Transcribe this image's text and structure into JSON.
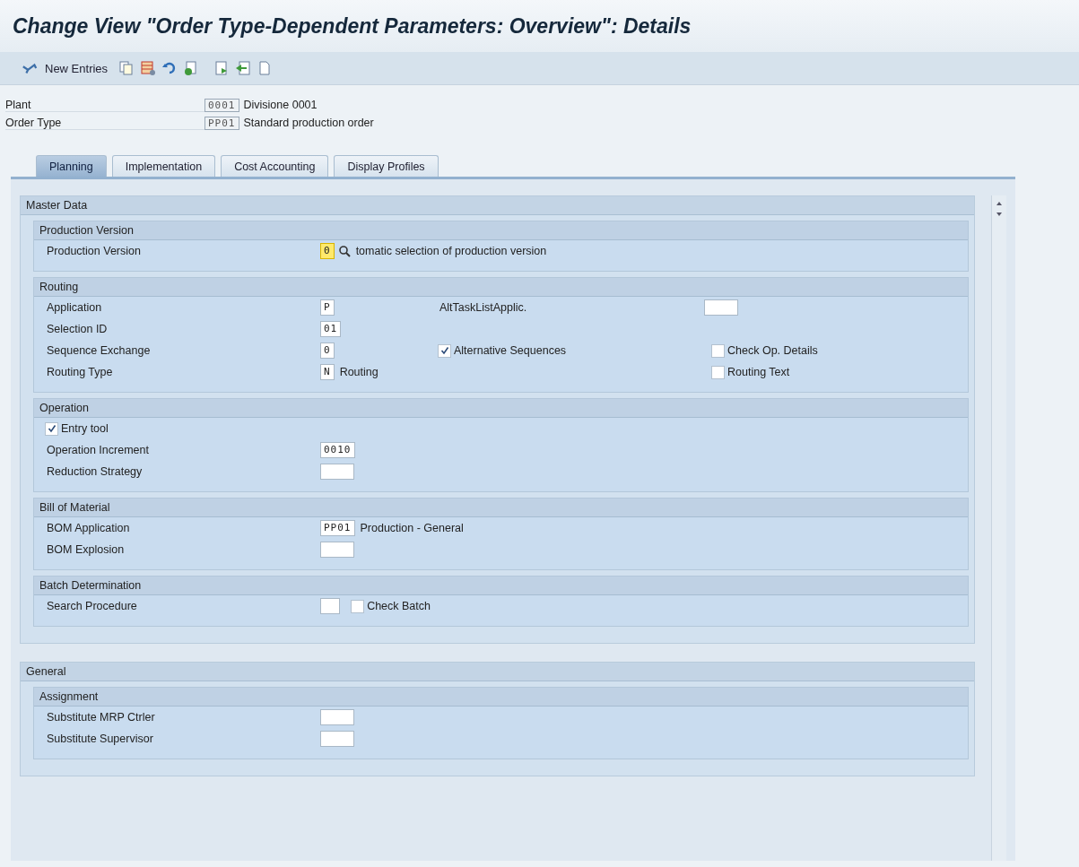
{
  "window": {
    "title": "Change View \"Order Type-Dependent Parameters: Overview\": Details"
  },
  "toolbar": {
    "new_entries": "New Entries"
  },
  "header": [
    {
      "label": "Plant",
      "value": "0001",
      "description": "Divisione 0001"
    },
    {
      "label": "Order Type",
      "value": "PP01",
      "description": "Standard production order"
    }
  ],
  "tabs": [
    {
      "label": "Planning",
      "selected": true
    },
    {
      "label": "Implementation",
      "selected": false
    },
    {
      "label": "Cost Accounting",
      "selected": false
    },
    {
      "label": "Display Profiles",
      "selected": false
    }
  ],
  "sections": [
    {
      "title": "Master Data",
      "groups": [
        {
          "title": "Production Version",
          "rows": [
            {
              "cells": [
                [
                  {
                    "kind": "label",
                    "text": "Production Version"
                  }
                ],
                [
                  {
                    "kind": "field",
                    "value": "0",
                    "focused": true
                  },
                  {
                    "kind": "search_help"
                  },
                  {
                    "kind": "text",
                    "text": "tomatic selection of production version"
                  }
                ]
              ]
            }
          ]
        },
        {
          "title": "Routing",
          "rows": [
            {
              "cells": [
                [
                  {
                    "kind": "label",
                    "text": "Application"
                  }
                ],
                [
                  {
                    "kind": "field",
                    "value": "P"
                  }
                ],
                [
                  {
                    "kind": "label",
                    "text": "AltTaskListApplic."
                  }
                ],
                [
                  {
                    "kind": "field"
                  }
                ]
              ]
            },
            {
              "cells": [
                [
                  {
                    "kind": "label",
                    "text": "Selection ID"
                  }
                ],
                [
                  {
                    "kind": "field",
                    "value": "01"
                  }
                ]
              ]
            },
            {
              "cells": [
                [
                  {
                    "kind": "label",
                    "text": "Sequence Exchange"
                  }
                ],
                [
                  {
                    "kind": "field",
                    "value": "0"
                  }
                ],
                [
                  {
                    "kind": "checkbox",
                    "label": "Alternative Sequences",
                    "checked": true
                  }
                ],
                [
                  {
                    "kind": "checkbox",
                    "label": "Check Op. Details",
                    "checked": false
                  }
                ]
              ]
            },
            {
              "cells": [
                [
                  {
                    "kind": "label",
                    "text": "Routing Type"
                  }
                ],
                [
                  {
                    "kind": "field",
                    "value": "N"
                  },
                  {
                    "kind": "text",
                    "text": "Routing"
                  }
                ],
                [],
                [
                  {
                    "kind": "checkbox",
                    "label": "Routing Text",
                    "checked": false
                  }
                ]
              ]
            }
          ]
        },
        {
          "title": "Operation",
          "rows": [
            {
              "cells": [
                [
                  {
                    "kind": "checkbox",
                    "label": "Entry tool",
                    "checked": true
                  }
                ]
              ]
            },
            {
              "cells": [
                [
                  {
                    "kind": "label",
                    "text": "Operation Increment"
                  }
                ],
                [
                  {
                    "kind": "field",
                    "value": "0010"
                  }
                ]
              ]
            },
            {
              "cells": [
                [
                  {
                    "kind": "label",
                    "text": "Reduction Strategy"
                  }
                ],
                [
                  {
                    "kind": "field"
                  }
                ]
              ]
            }
          ]
        },
        {
          "title": "Bill of Material",
          "rows": [
            {
              "cells": [
                [
                  {
                    "kind": "label",
                    "text": "BOM Application"
                  }
                ],
                [
                  {
                    "kind": "field",
                    "value": "PP01"
                  },
                  {
                    "kind": "text",
                    "text": "Production - General"
                  }
                ]
              ]
            },
            {
              "cells": [
                [
                  {
                    "kind": "label",
                    "text": "BOM Explosion"
                  }
                ],
                [
                  {
                    "kind": "field"
                  }
                ]
              ]
            }
          ]
        },
        {
          "title": "Batch Determination",
          "rows": [
            {
              "cells": [
                [
                  {
                    "kind": "label",
                    "text": "Search Procedure"
                  }
                ],
                [
                  {
                    "kind": "field"
                  },
                  {
                    "kind": "checkbox",
                    "label": "Check Batch",
                    "checked": false
                  }
                ]
              ]
            }
          ]
        }
      ]
    },
    {
      "title": "General",
      "groups": [
        {
          "title": "Assignment",
          "rows": [
            {
              "cells": [
                [
                  {
                    "kind": "label",
                    "text": "Substitute MRP Ctrler"
                  }
                ],
                [
                  {
                    "kind": "field"
                  }
                ]
              ]
            },
            {
              "cells": [
                [
                  {
                    "kind": "label",
                    "text": "Substitute Supervisor"
                  }
                ],
                [
                  {
                    "kind": "field"
                  }
                ]
              ]
            }
          ]
        }
      ]
    }
  ]
}
